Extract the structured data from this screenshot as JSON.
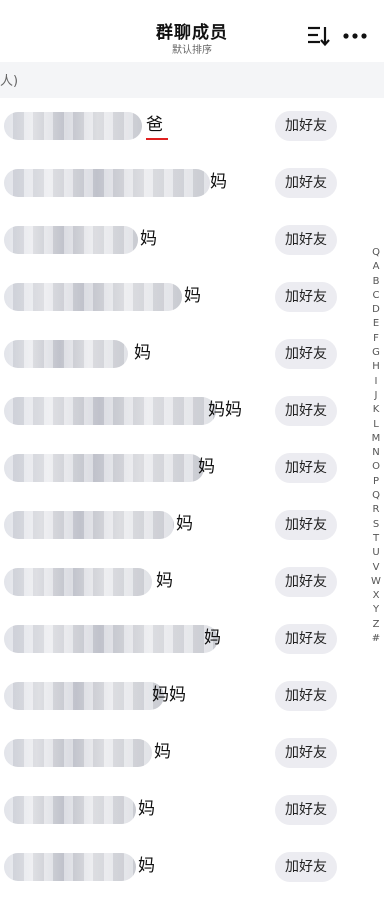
{
  "header": {
    "title": "群聊成员",
    "subtitle": "默认排序"
  },
  "section": {
    "label": "人)"
  },
  "add_friend_label": "加好友",
  "accent_color": "#e02020",
  "members": [
    {
      "name_visible": "爸"
    },
    {
      "name_visible": "妈"
    },
    {
      "name_visible": "妈"
    },
    {
      "name_visible": "妈"
    },
    {
      "name_visible": "妈"
    },
    {
      "name_visible": "妈妈"
    },
    {
      "name_visible": "妈"
    },
    {
      "name_visible": "妈"
    },
    {
      "name_visible": "妈"
    },
    {
      "name_visible": "妈"
    },
    {
      "name_visible": "妈妈"
    },
    {
      "name_visible": "妈"
    },
    {
      "name_visible": "妈"
    },
    {
      "name_visible": "妈"
    }
  ],
  "index_letters": [
    "Q",
    "A",
    "B",
    "C",
    "D",
    "E",
    "F",
    "G",
    "H",
    "I",
    "J",
    "K",
    "L",
    "M",
    "N",
    "O",
    "P",
    "Q",
    "R",
    "S",
    "T",
    "U",
    "V",
    "W",
    "X",
    "Y",
    "Z",
    "#"
  ]
}
